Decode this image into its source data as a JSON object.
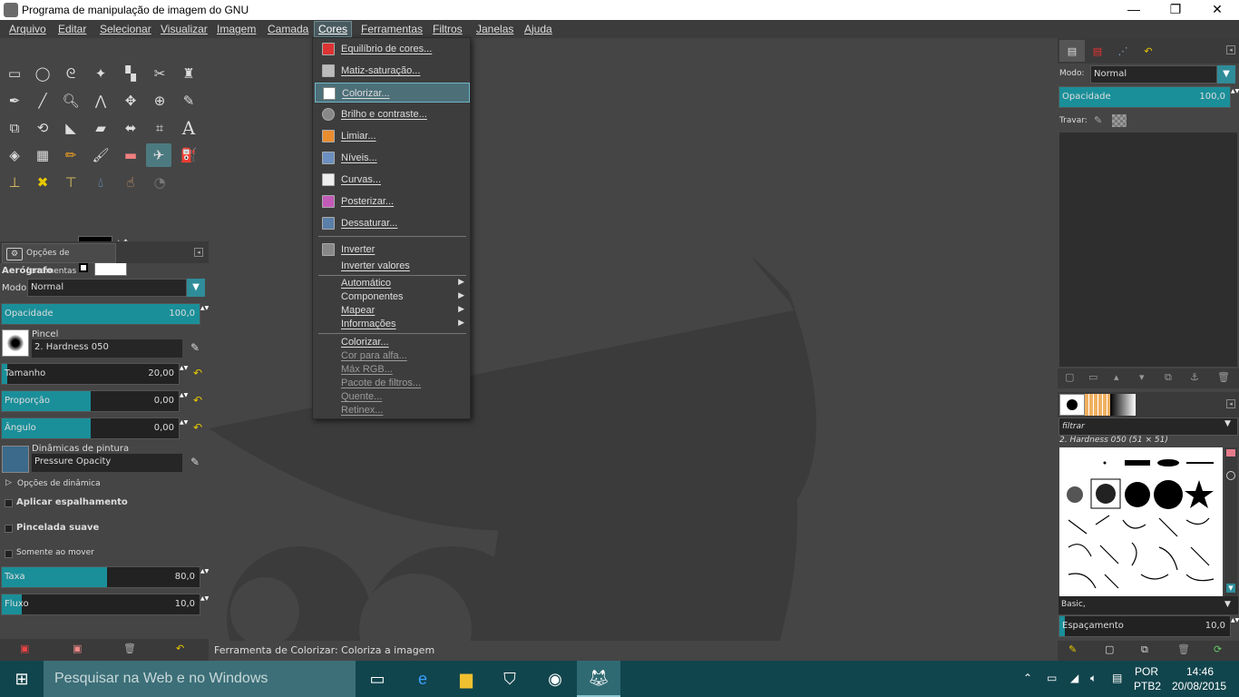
{
  "window": {
    "title": "Programa de manipulação de imagem do GNU",
    "minimize": "—",
    "maximize": "❐",
    "close": "✕"
  },
  "menubar": [
    "Arquivo",
    "Editar",
    "Selecionar",
    "Visualizar",
    "Imagem",
    "Camada",
    "Cores",
    "Ferramentas",
    "Filtros",
    "Janelas",
    "Ajuda"
  ],
  "colors_menu": {
    "items": [
      {
        "label": "Equilíbrio de cores...",
        "icon": "color-balance-icon"
      },
      {
        "label": "Matiz-saturação...",
        "icon": "hue-saturation-icon"
      },
      {
        "label": "Colorizar...",
        "icon": "colorize-icon",
        "highlighted": true
      },
      {
        "label": "Brilho e contraste...",
        "icon": "brightness-contrast-icon"
      },
      {
        "label": "Limiar...",
        "icon": "threshold-icon"
      },
      {
        "label": "Níveis...",
        "icon": "levels-icon"
      },
      {
        "label": "Curvas...",
        "icon": "curves-icon"
      },
      {
        "label": "Posterizar...",
        "icon": "posterize-icon"
      },
      {
        "label": "Dessaturar...",
        "icon": "desaturate-icon"
      }
    ],
    "invert": "Inverter",
    "invert_values": "Inverter valores",
    "submenus": [
      "Automático",
      "Componentes",
      "Mapear",
      "Informações"
    ],
    "plugins": [
      "Colorizar...",
      "Cor para alfa...",
      "Máx RGB...",
      "Pacote de filtros...",
      "Quente...",
      "Retinex..."
    ]
  },
  "tool_options": {
    "tab_label": "Opções de ferramentas",
    "tool_name": "Aerógrafo",
    "mode_label": "Modo:",
    "mode_value": "Normal",
    "opacity_label": "Opacidade",
    "opacity_value": "100,0",
    "brush_label": "Pincel",
    "brush_value": "2. Hardness 050",
    "size_label": "Tamanho",
    "size_value": "20,00",
    "ratio_label": "Proporção",
    "ratio_value": "0,00",
    "angle_label": "Ângulo",
    "angle_value": "0,00",
    "dynamics_label": "Dinâmicas de pintura",
    "dynamics_value": "Pressure Opacity",
    "dynamics_options": "Opções de dinâmica",
    "apply_jitter": "Aplicar espalhamento",
    "smooth_stroke": "Pincelada suave",
    "motion_only": "Somente ao mover",
    "rate_label": "Taxa",
    "rate_value": "80,0",
    "flow_label": "Fluxo",
    "flow_value": "10,0"
  },
  "status": "Ferramenta de Colorizar: Coloriza a imagem",
  "layers": {
    "mode_label": "Modo:",
    "mode_value": "Normal",
    "opacity_label": "Opacidade",
    "opacity_value": "100,0",
    "lock_label": "Travar:"
  },
  "brushes": {
    "filter": "filtrar",
    "current": "2. Hardness 050 (51 × 51)",
    "tag": "Basic,",
    "spacing_label": "Espaçamento",
    "spacing_value": "10,0"
  },
  "taskbar": {
    "search": "Pesquisar na Web e no Windows",
    "lang": "POR",
    "layout": "PTB2",
    "time": "14:46",
    "date": "20/08/2015"
  },
  "accent": "#1a8f99",
  "progress": {
    "opacity": 1.0,
    "ratio": 0.43,
    "angle": 0.43,
    "rate": 0.5,
    "flow": 0.09,
    "spacing": 0.04
  }
}
